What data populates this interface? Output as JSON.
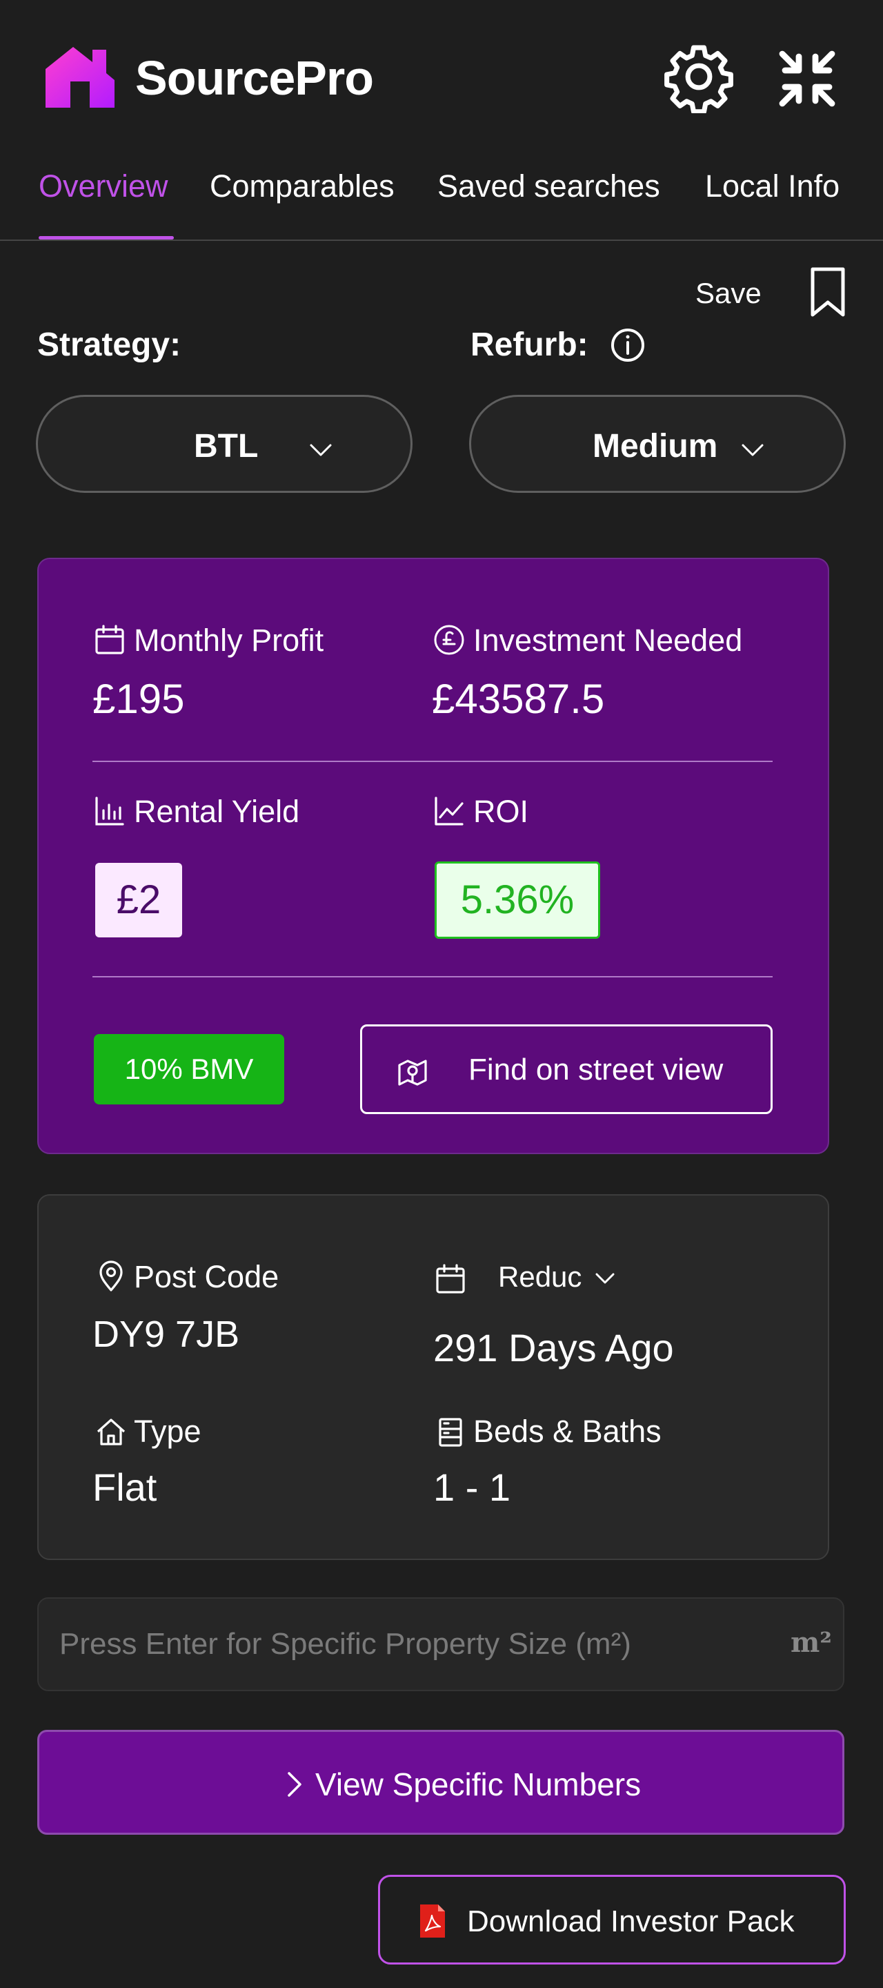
{
  "app": {
    "brand": "SourcePro",
    "brand_color": "#c052e8",
    "icons": {
      "logo": "house-logo-icon",
      "settings": "gear-icon",
      "collapse": "shrink-arrows-icon"
    }
  },
  "tabs": [
    {
      "label": "Overview",
      "active": true
    },
    {
      "label": "Comparables",
      "active": false
    },
    {
      "label": "Saved searches",
      "active": false
    },
    {
      "label": "Local Info",
      "active": false
    }
  ],
  "save": {
    "label": "Save",
    "icon": "bookmark-icon"
  },
  "strategy": {
    "label": "Strategy:",
    "value": "BTL"
  },
  "refurb": {
    "label": "Refurb:",
    "value": "Medium",
    "info_icon": "info-icon"
  },
  "metrics": {
    "monthly_profit": {
      "label": "Monthly Profit",
      "value": "£195",
      "icon": "calendar-icon"
    },
    "investment_needed": {
      "label": "Investment Needed",
      "value": "£43587.5",
      "icon": "pound-coin-icon"
    },
    "rental_yield": {
      "label": "Rental Yield",
      "value": "£2",
      "icon": "bar-chart-icon"
    },
    "roi": {
      "label": "ROI",
      "value": "5.36%",
      "icon": "line-chart-icon"
    },
    "bmv_badge": "10% BMV",
    "street_view_button": "Find on street view",
    "colors": {
      "card": "#5c0b7b",
      "bmv": "#16b416",
      "roi_text": "#22b322"
    }
  },
  "property": {
    "post_code": {
      "label": "Post Code",
      "value": "DY9 7JB",
      "icon": "location-pin-icon"
    },
    "reduced": {
      "label": "Reduc",
      "value": "291 Days Ago",
      "icon": "calendar-icon"
    },
    "type": {
      "label": "Type",
      "value": "Flat",
      "icon": "home-icon"
    },
    "beds_baths": {
      "label": "Beds & Baths",
      "value": "1 - 1",
      "icon": "bed-bath-icon"
    }
  },
  "size_input": {
    "placeholder": "Press Enter for Specific Property Size (m²)",
    "unit": "m²"
  },
  "specific_numbers_button": "View Specific Numbers",
  "download_button": {
    "label": "Download Investor Pack",
    "icon": "pdf-icon"
  }
}
